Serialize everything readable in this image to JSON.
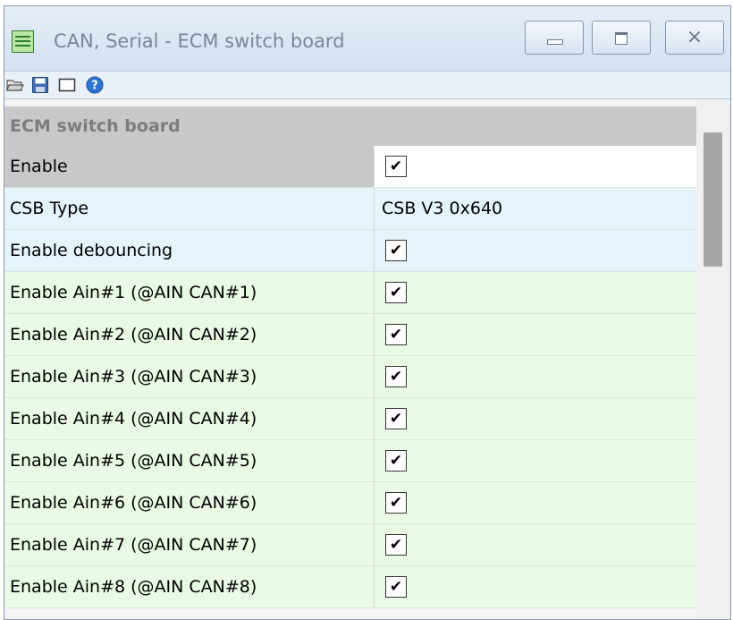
{
  "window": {
    "title": "CAN, Serial - ECM switch board",
    "icon": "property-grid-icon",
    "controls": [
      "minimize-icon",
      "maximize-icon",
      "close-icon"
    ],
    "close_glyph": "⨯"
  },
  "toolbar": {
    "icons": [
      "open-folder-icon",
      "save-icon",
      "view-icon",
      "help-icon"
    ]
  },
  "section": {
    "title": "ECM switch board"
  },
  "checkmark": "✔",
  "rows": [
    {
      "label": "Enable",
      "type": "checkbox",
      "checked": true
    },
    {
      "label": "CSB Type",
      "type": "text",
      "value": "CSB V3 0x640"
    },
    {
      "label": "Enable debouncing",
      "type": "checkbox",
      "checked": true
    },
    {
      "label": "Enable Ain#1 (@AIN CAN#1)",
      "type": "checkbox",
      "checked": true
    },
    {
      "label": "Enable Ain#2 (@AIN CAN#2)",
      "type": "checkbox",
      "checked": true
    },
    {
      "label": "Enable Ain#3 (@AIN CAN#3)",
      "type": "checkbox",
      "checked": true
    },
    {
      "label": "Enable Ain#4 (@AIN CAN#4)",
      "type": "checkbox",
      "checked": true
    },
    {
      "label": "Enable Ain#5 (@AIN CAN#5)",
      "type": "checkbox",
      "checked": true
    },
    {
      "label": "Enable Ain#6 (@AIN CAN#6)",
      "type": "checkbox",
      "checked": true
    },
    {
      "label": "Enable Ain#7 (@AIN CAN#7)",
      "type": "checkbox",
      "checked": true
    },
    {
      "label": "Enable Ain#8 (@AIN CAN#8)",
      "type": "checkbox",
      "checked": true
    }
  ],
  "colors": {
    "selected_label_bg": "#c8c8c8",
    "selected_value_bg": "#ffffff",
    "blue_row_bg": "#e5f3fb",
    "green_row_bg": "#e9fbe4",
    "section_bg": "#c8c8c8"
  }
}
